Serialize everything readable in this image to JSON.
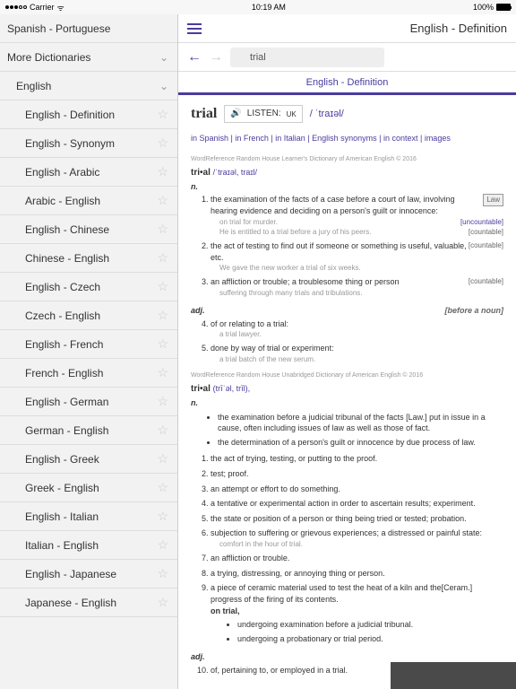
{
  "status": {
    "carrier": "Carrier",
    "wifi": "᯾",
    "time": "10:19 AM",
    "pct": "100%"
  },
  "sidebar": {
    "header1": "Spanish - Portuguese",
    "group": "More Dictionaries",
    "sub": "English",
    "items": [
      "English - Definition",
      "English - Synonym",
      "English - Arabic",
      "Arabic - English",
      "English - Chinese",
      "Chinese - English",
      "English - Czech",
      "Czech - English",
      "English - French",
      "French - English",
      "English - German",
      "German - English",
      "English - Greek",
      "Greek - English",
      "English - Italian",
      "Italian - English",
      "English - Japanese",
      "Japanese - English"
    ]
  },
  "header": {
    "title": "English - Definition"
  },
  "search": {
    "value": "trial"
  },
  "tab": "English - Definition",
  "entry": {
    "word": "trial",
    "listen": "LISTEN:",
    "region": "UK",
    "ipa": "/ ˈtraɪəl/",
    "links": "in Spanish | in French | in Italian | English synonyms | in context | images",
    "src1": "WordReference Random House Learner's Dictionary of American English © 2016",
    "pron1": "/ˈtraɪəl, traɪl/",
    "n": "n.",
    "d1": {
      "1": "the examination of the facts of a case before a court of law, involving hearing evidence and deciding on a person's guilt or innocence:",
      "1ex1": "on trial for murder.",
      "1t1": "[uncountable]",
      "1ex2": "He is entitled to a trial before a jury of his peers.",
      "1t2": "[countable]",
      "1law": "Law",
      "2": "the act of testing to find out if someone or something is useful, valuable, etc.",
      "2ex": "We gave the new worker a trial of six weeks.",
      "2t": "[countable]",
      "3": "an affliction or trouble; a troublesome thing or person",
      "3t": "[countable]",
      "3ex": "suffering through many trials and tribulations."
    },
    "adj": "adj.",
    "adjnote": "[before a noun]",
    "d2": {
      "4": "of or relating to a trial:",
      "4ex": "a trial lawyer.",
      "5": "done by way of trial or experiment:",
      "5ex": "a trial batch of the new serum."
    },
    "src2": "WordReference Random House Unabridged Dictionary of American English © 2016",
    "pron2": "(trīˈəl, trīl),",
    "b1": "the examination before a judicial tribunal of the facts  [Law.] put in issue in a cause, often including issues of law as well as those of fact.",
    "b2": "the determination of a person's guilt or innocence by due process of law.",
    "u": {
      "1": "the act of trying, testing, or putting to the proof.",
      "2": "test; proof.",
      "3": "an attempt or effort to do something.",
      "4": "a tentative or experimental action in order to ascertain results; experiment.",
      "5": "the state or position of a person or thing being tried or tested; probation.",
      "6": "subjection to suffering or grievous experiences; a distressed or painful state:",
      "6ex": "comfort in the hour of trial.",
      "7": "an affliction or trouble.",
      "8": "a trying, distressing, or annoying thing or person.",
      "9": "a piece of ceramic material used to test the heat of a kiln and the[Ceram.] progress of the firing of its contents.",
      "ontrial": "on trial,",
      "ot1": "undergoing examination before a judicial tribunal.",
      "ot2": "undergoing a probationary or trial period."
    },
    "adj10": "of, pertaining to, or employed in a trial."
  }
}
